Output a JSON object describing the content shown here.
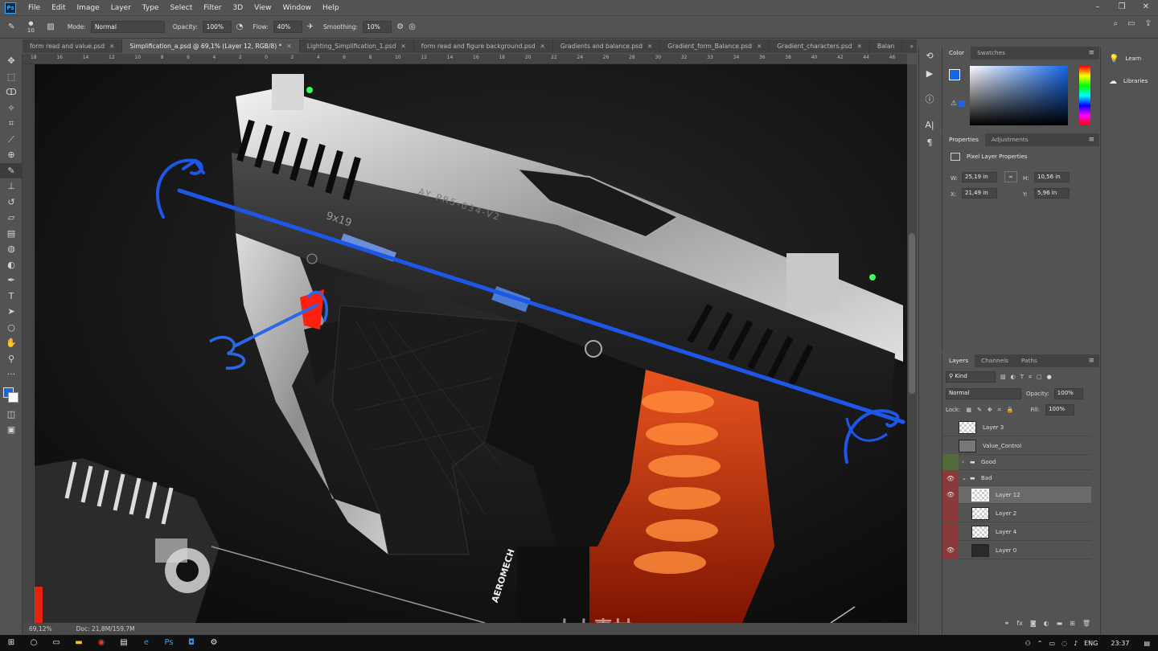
{
  "app": {
    "logo": "Ps"
  },
  "menubar": {
    "items": [
      "File",
      "Edit",
      "Image",
      "Layer",
      "Type",
      "Select",
      "Filter",
      "3D",
      "View",
      "Window",
      "Help"
    ]
  },
  "watermark_top": "www.rrcg.cn",
  "watermark_bottom": "人人素材",
  "options": {
    "brush_size": "10",
    "mode_label": "Mode:",
    "mode_value": "Normal",
    "opacity_label": "Opacity:",
    "opacity_value": "100%",
    "flow_label": "Flow:",
    "flow_value": "40%",
    "smoothing_label": "Smoothing:",
    "smoothing_value": "10%"
  },
  "tabs": [
    {
      "label": "form read and value.psd",
      "active": false
    },
    {
      "label": "Simplification_a.psd @ 69,1% (Layer 12, RGB/8) *",
      "active": true
    },
    {
      "label": "Lighting_Simplification_1.psd",
      "active": false
    },
    {
      "label": "form read and figure background.psd",
      "active": false
    },
    {
      "label": "Gradients and balance.psd",
      "active": false
    },
    {
      "label": "Gradient_form_Balance.psd",
      "active": false
    },
    {
      "label": "Gradient_characters.psd",
      "active": false
    },
    {
      "label": "Balan",
      "active": false
    }
  ],
  "ruler_ticks": [
    "18",
    "16",
    "14",
    "12",
    "10",
    "8",
    "6",
    "4",
    "2",
    "0",
    "2",
    "4",
    "6",
    "8",
    "10",
    "12",
    "14",
    "16",
    "18",
    "20",
    "22",
    "24",
    "26",
    "28",
    "30",
    "32",
    "33",
    "34",
    "36",
    "38",
    "40",
    "42",
    "44",
    "46"
  ],
  "status": {
    "zoom": "69,12%",
    "doc": "Doc: 21,8M/159,7M"
  },
  "color_panel": {
    "tabs": [
      "Color",
      "Swatches"
    ]
  },
  "properties_panel": {
    "tabs": [
      "Properties",
      "Adjustments"
    ],
    "title": "Pixel Layer Properties",
    "w_label": "W:",
    "w_value": "25,19 in",
    "h_label": "H:",
    "h_value": "10,56 in",
    "x_label": "X:",
    "x_value": "21,49 in",
    "y_label": "Y:",
    "y_value": "5,96 in"
  },
  "learn_panel": {
    "learn": "Learn",
    "libraries": "Libraries"
  },
  "layers_panel": {
    "tabs": [
      "Layers",
      "Channels",
      "Paths"
    ],
    "kind_label": "Kind",
    "blend_mode": "Normal",
    "opacity_label": "Opacity:",
    "opacity_value": "100%",
    "lock_label": "Lock:",
    "fill_label": "Fill:",
    "fill_value": "100%",
    "layers": [
      {
        "name": "Layer 3",
        "visible": false,
        "type": "layer",
        "tag": "none"
      },
      {
        "name": "Value_Control",
        "visible": false,
        "type": "layer",
        "tag": "none"
      },
      {
        "name": "Good",
        "visible": false,
        "type": "group",
        "tag": "green"
      },
      {
        "name": "Bad",
        "visible": true,
        "type": "group",
        "tag": "red"
      },
      {
        "name": "Layer 12",
        "visible": true,
        "type": "layer",
        "tag": "red",
        "selected": true
      },
      {
        "name": "Layer 2",
        "visible": false,
        "type": "layer",
        "tag": "red"
      },
      {
        "name": "Layer 4",
        "visible": false,
        "type": "layer",
        "tag": "red"
      },
      {
        "name": "Layer 0",
        "visible": true,
        "type": "layer",
        "tag": "red"
      }
    ]
  },
  "artwork": {
    "slide_engraving": "AY PR5-034-V2",
    "caliber": "9x19",
    "mag_brand": "AEROMECH"
  },
  "taskbar": {
    "time": "23:37",
    "lang": "ENG"
  }
}
